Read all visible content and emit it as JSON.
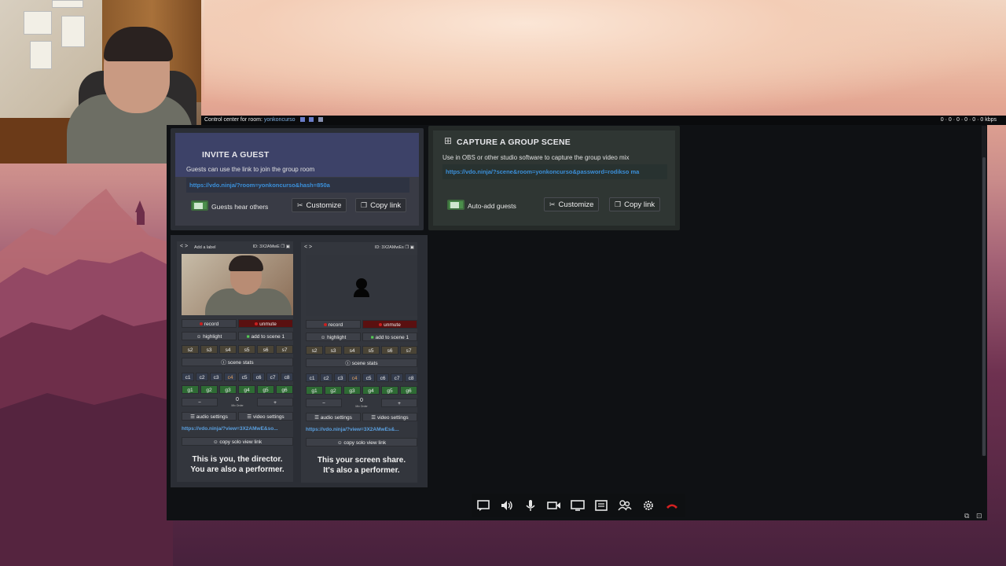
{
  "topbar": {
    "control_label": "Control center for room:",
    "room_name": "yonkoncurso",
    "stats": "0 · 0 · 0 · 0 · 0 · 0 kbps"
  },
  "invite": {
    "title": "INVITE A GUEST",
    "description": "Guests can use the link to join the group room",
    "link": "https://vdo.ninja/?room=yonkoncurso&hash=850a",
    "toggle_label": "Guests hear others",
    "customize_label": "Customize",
    "copy_label": "Copy link"
  },
  "capture": {
    "title": "CAPTURE A GROUP SCENE",
    "description": "Use in OBS or other studio software to capture the group video mix",
    "link": "https://vdo.ninja/?scene&room=yonkoncurso&password=rodikso ma",
    "toggle_label": "Auto-add guests",
    "customize_label": "Customize",
    "copy_label": "Copy link"
  },
  "cards": [
    {
      "label": "Add a label",
      "id": "ID: 3X2AMwE",
      "record": "record",
      "mute": "unmute",
      "highlight": "highlight",
      "add_scene": "add to scene 1",
      "scenes": [
        "s2",
        "s3",
        "s4",
        "s5",
        "s6",
        "s7"
      ],
      "scene_stats": "scene stats",
      "channels": [
        "c1",
        "c2",
        "c3",
        "c4",
        "c5",
        "c6",
        "c7",
        "c8"
      ],
      "groups": [
        "g1",
        "g2",
        "g3",
        "g4",
        "g5",
        "g6"
      ],
      "minus": "−",
      "mix_value": "0",
      "mix_label": "Mix Order",
      "plus": "+",
      "audio_settings": "audio settings",
      "video_settings": "video settings",
      "view_link": "https://vdo.ninja/?view=3X2AMwE&so...",
      "solo_link": "copy solo view link",
      "note_line1": "This is you, the director.",
      "note_line2": "You are also a performer."
    },
    {
      "label": "",
      "id": "ID: 3X2AMwEs",
      "record": "record",
      "mute": "unmute",
      "highlight": "highlight",
      "add_scene": "add to scene 1",
      "scenes": [
        "s2",
        "s3",
        "s4",
        "s5",
        "s6",
        "s7"
      ],
      "scene_stats": "scene stats",
      "channels": [
        "c1",
        "c2",
        "c3",
        "c4",
        "c5",
        "c6",
        "c7",
        "c8"
      ],
      "groups": [
        "g1",
        "g2",
        "g3",
        "g4",
        "g5",
        "g6"
      ],
      "minus": "−",
      "mix_value": "0",
      "mix_label": "Mix Order",
      "plus": "+",
      "audio_settings": "audio settings",
      "video_settings": "video settings",
      "view_link": "https://vdo.ninja/?view=3X2AMwEs&...",
      "solo_link": "copy solo view link",
      "note_line1": "This your screen share.",
      "note_line2": "It's also a performer."
    }
  ],
  "toolbar": {
    "icons": [
      "chat-icon",
      "speaker-icon",
      "microphone-icon",
      "camera-icon",
      "screen-share-icon",
      "whiteboard-icon",
      "participants-icon",
      "settings-icon",
      "hangup-icon"
    ]
  },
  "colors": {
    "accent_link": "#3b8fd9",
    "toggle_on": "#4b8f4b",
    "hangup": "#d42020"
  }
}
